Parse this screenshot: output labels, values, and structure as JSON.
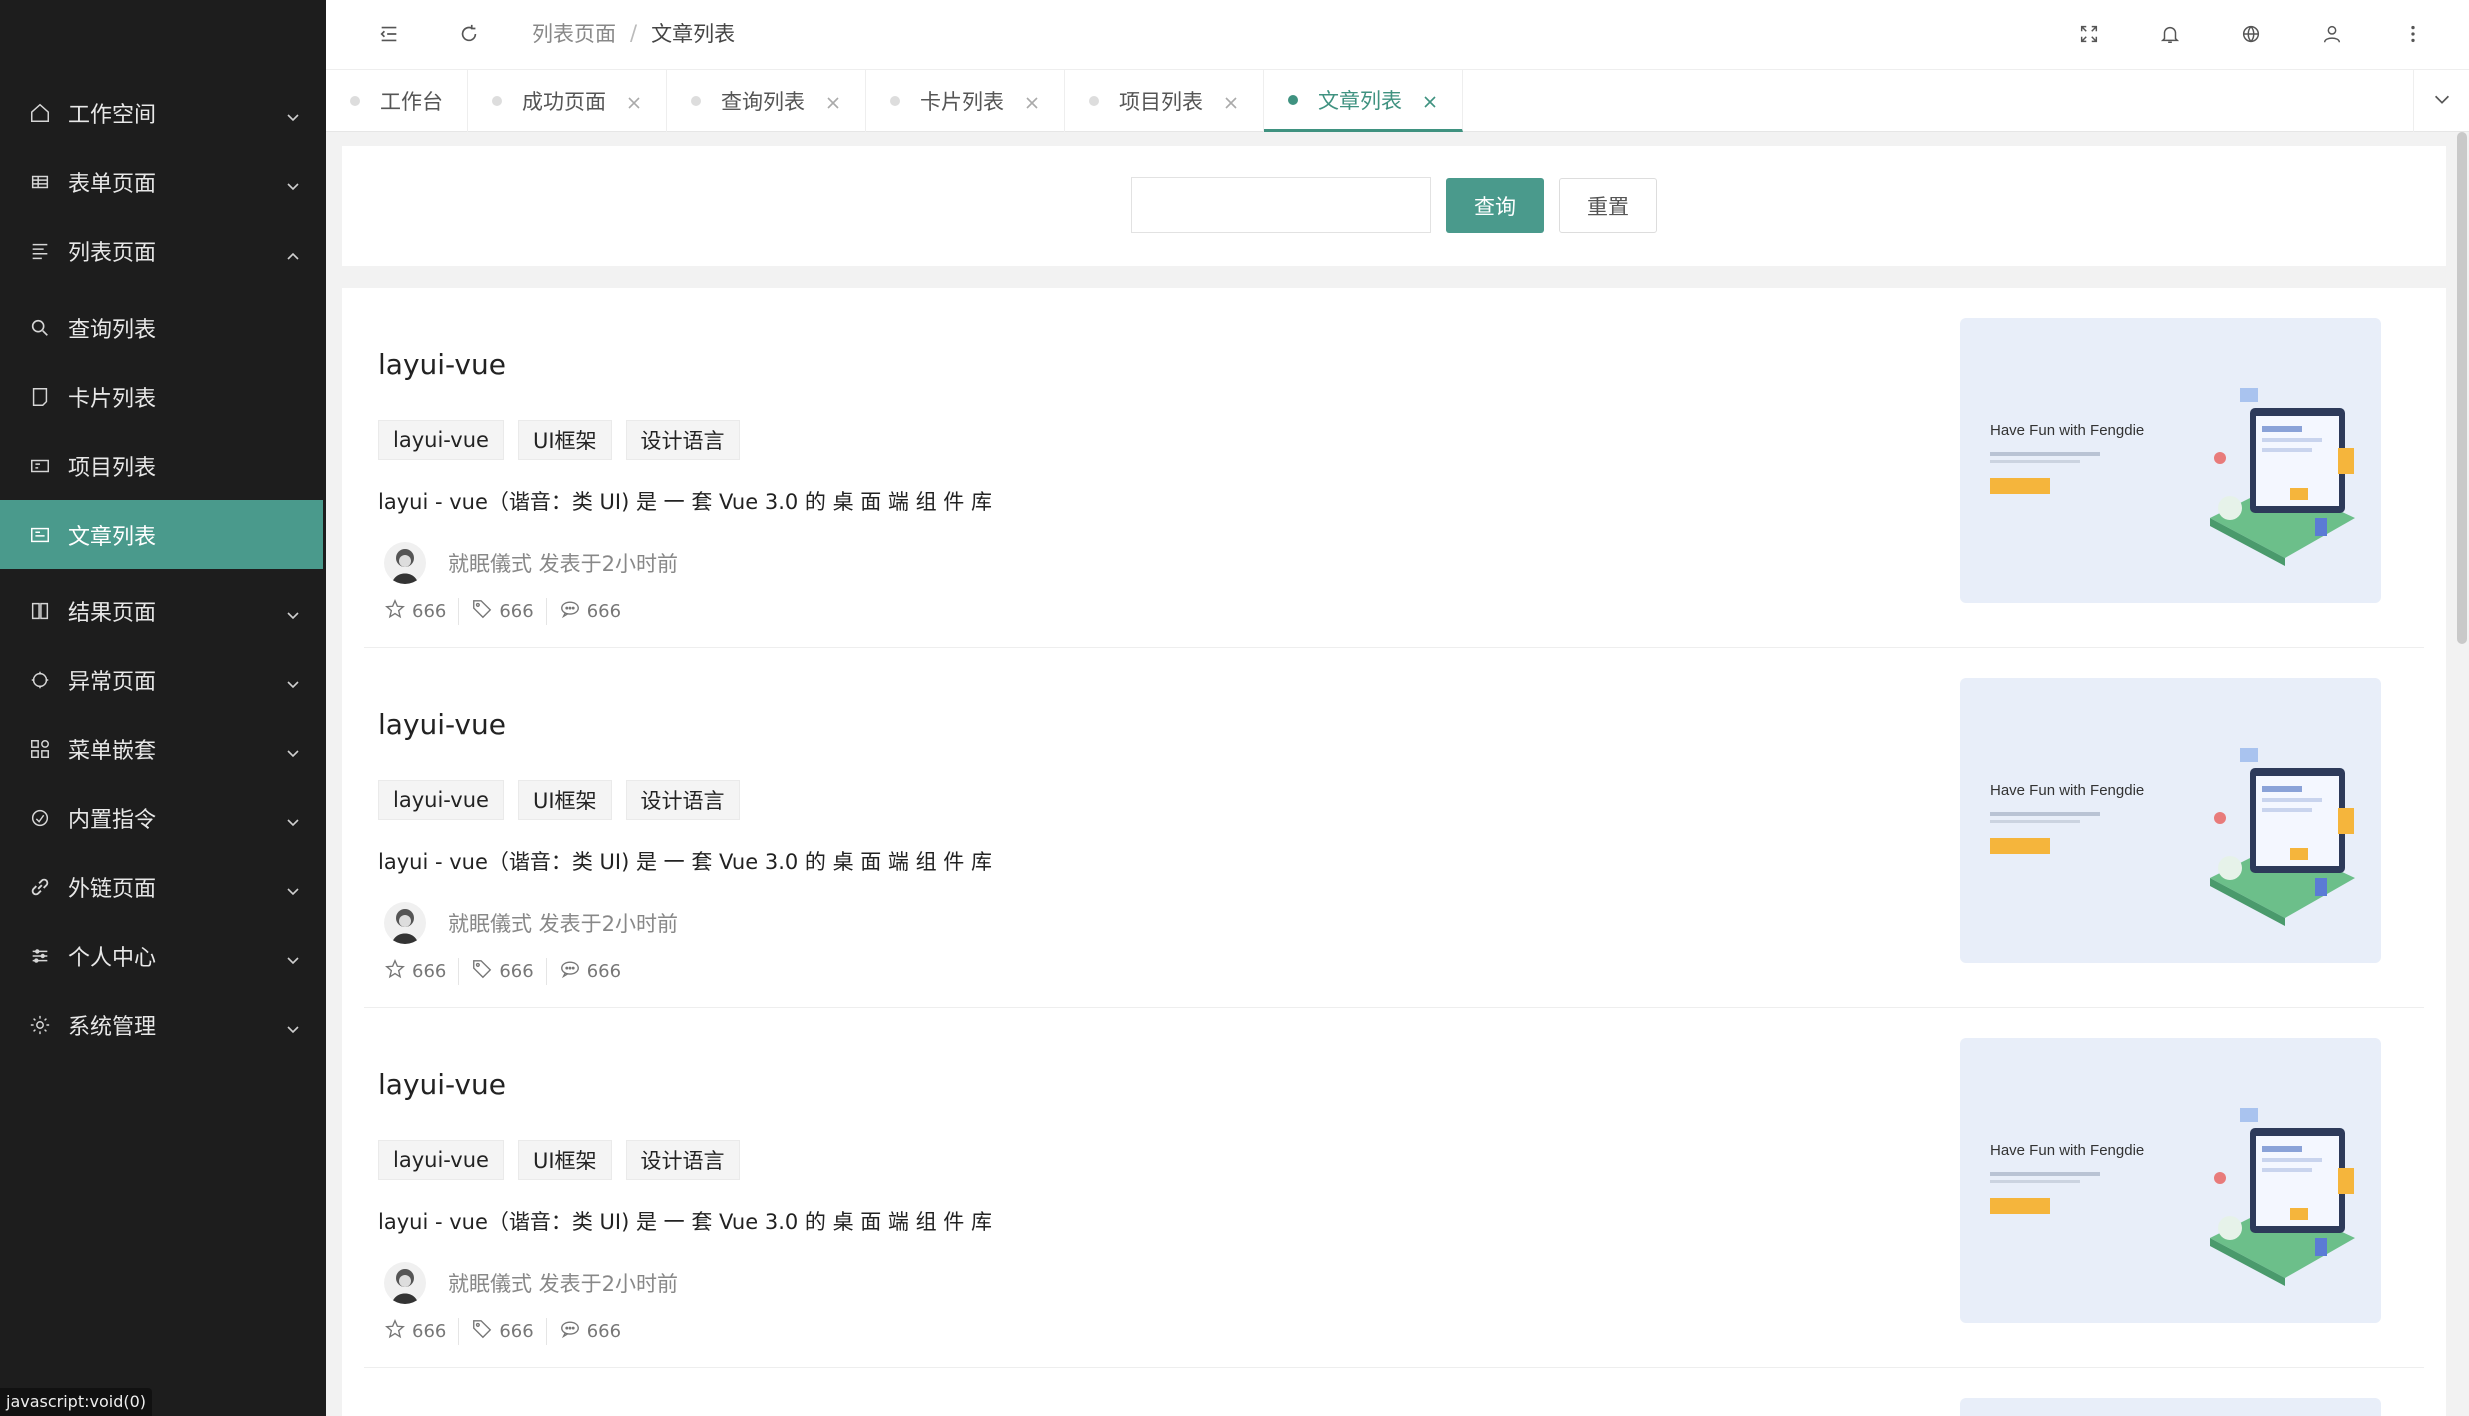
{
  "sidebar": {
    "items": [
      {
        "label": "工作空间",
        "icon": "home-icon",
        "arrow": "down"
      },
      {
        "label": "表单页面",
        "icon": "table-icon",
        "arrow": "down"
      },
      {
        "label": "列表页面",
        "icon": "list-icon",
        "arrow": "up"
      }
    ],
    "subitems": [
      {
        "label": "查询列表",
        "icon": "search-icon"
      },
      {
        "label": "卡片列表",
        "icon": "card-icon"
      },
      {
        "label": "项目列表",
        "icon": "project-icon"
      },
      {
        "label": "文章列表",
        "icon": "article-icon",
        "active": true
      }
    ],
    "items_after": [
      {
        "label": "结果页面",
        "icon": "result-icon"
      },
      {
        "label": "异常页面",
        "icon": "error-icon"
      },
      {
        "label": "菜单嵌套",
        "icon": "nested-menu-icon"
      },
      {
        "label": "内置指令",
        "icon": "directive-icon"
      },
      {
        "label": "外链页面",
        "icon": "link-icon"
      },
      {
        "label": "个人中心",
        "icon": "profile-icon"
      },
      {
        "label": "系统管理",
        "icon": "settings-icon"
      }
    ],
    "status_url": "javascript:void(0)"
  },
  "header": {
    "breadcrumb": [
      "列表页面",
      "文章列表"
    ],
    "breadcrumb_sep": "/"
  },
  "tabs": [
    {
      "label": "工作台",
      "closable": false
    },
    {
      "label": "成功页面",
      "closable": true
    },
    {
      "label": "查询列表",
      "closable": true
    },
    {
      "label": "卡片列表",
      "closable": true
    },
    {
      "label": "项目列表",
      "closable": true
    },
    {
      "label": "文章列表",
      "closable": true,
      "active": true
    }
  ],
  "search": {
    "value": "",
    "query_label": "查询",
    "reset_label": "重置"
  },
  "articles": [
    {
      "title": "layui-vue",
      "tags": [
        "layui-vue",
        "UI框架",
        "设计语言"
      ],
      "desc": "layui - vue（谐音：类 UI) 是 一 套 Vue 3.0 的 桌 面 端 组 件 库",
      "author_line": "就眠儀式 发表于2小时前",
      "stars": "666",
      "tags_count": "666",
      "comments": "666",
      "image_title": "Have Fun with Fengdie"
    },
    {
      "title": "layui-vue",
      "tags": [
        "layui-vue",
        "UI框架",
        "设计语言"
      ],
      "desc": "layui - vue（谐音：类 UI) 是 一 套 Vue 3.0 的 桌 面 端 组 件 库",
      "author_line": "就眠儀式 发表于2小时前",
      "stars": "666",
      "tags_count": "666",
      "comments": "666",
      "image_title": "Have Fun with Fengdie"
    },
    {
      "title": "layui-vue",
      "tags": [
        "layui-vue",
        "UI框架",
        "设计语言"
      ],
      "desc": "layui - vue（谐音：类 UI) 是 一 套 Vue 3.0 的 桌 面 端 组 件 库",
      "author_line": "就眠儀式 发表于2小时前",
      "stars": "666",
      "tags_count": "666",
      "comments": "666",
      "image_title": "Have Fun with Fengdie"
    }
  ],
  "colors": {
    "accent": "#4a9a8c",
    "sidebar_bg": "#1d1d1d",
    "image_bg": "#e8eef9",
    "image_button": "#f5b53c"
  }
}
